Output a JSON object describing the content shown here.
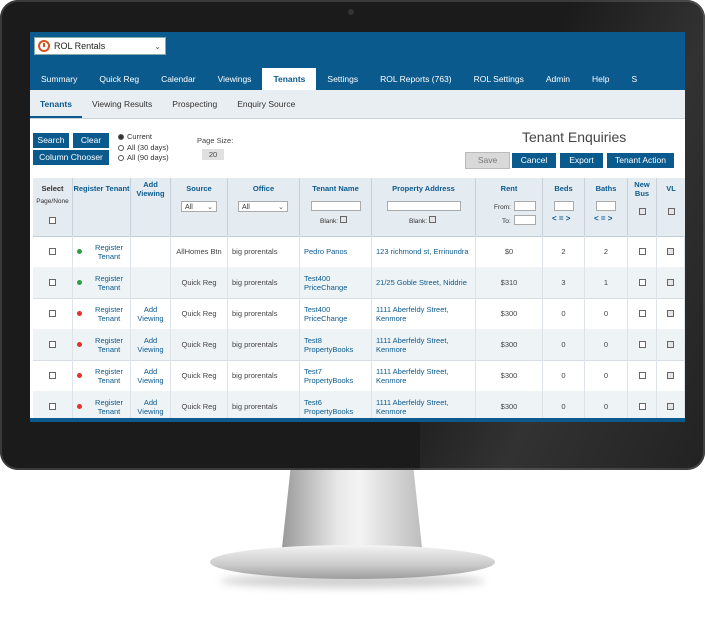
{
  "app": {
    "name": "ROL Rentals"
  },
  "nav": [
    "Summary",
    "Quick Reg",
    "Calendar",
    "Viewings",
    "Tenants",
    "Settings",
    "ROL Reports (763)",
    "ROL Settings",
    "Admin",
    "Help",
    "S"
  ],
  "subnav": [
    "Tenants",
    "Viewing Results",
    "Prospecting",
    "Enquiry Source"
  ],
  "controls": {
    "search": "Search",
    "clear": "Clear",
    "column_chooser": "Column Chooser",
    "radios": [
      "Current",
      "All (30 days)",
      "All (90 days)"
    ],
    "page_size_label": "Page Size:",
    "page_size": "20",
    "title": "Tenant Enquiries",
    "save": "Save",
    "cancel": "Cancel",
    "export": "Export",
    "tenant_action": "Tenant Action"
  },
  "headers": {
    "select": "Select",
    "page_none": "Page/None",
    "register_tenant": "Register Tenant",
    "add_viewing": "Add Viewing",
    "source": "Source",
    "source_filter": "All",
    "office": "Office",
    "office_filter": "All",
    "tenant_name": "Tenant Name",
    "property_address": "Property Address",
    "rent": "Rent",
    "from": "From:",
    "to": "To:",
    "blank": "Blank:",
    "beds": "Beds",
    "baths": "Baths",
    "new_bus": "New Bus",
    "vl": "VL",
    "arrows": "< = >"
  },
  "rows": [
    {
      "status": "#2e9e44",
      "register": "Register Tenant",
      "add": "",
      "source": "AllHomes Btn",
      "office": "big prorentals",
      "name": "Pedro Panos",
      "address": "123 richmond st, Errinundra",
      "rent": "$0",
      "beds": "2",
      "baths": "2"
    },
    {
      "status": "#2e9e44",
      "register": "Register Tenant",
      "add": "",
      "source": "Quick Reg",
      "office": "big prorentals",
      "name": "Test400 PriceChange",
      "address": "21/25 Goble Street, Niddrie",
      "rent": "$310",
      "beds": "3",
      "baths": "1"
    },
    {
      "status": "#e0332b",
      "register": "Register Tenant",
      "add": "Add Viewing",
      "source": "Quick Reg",
      "office": "big prorentals",
      "name": "Test400 PriceChange",
      "address": "1111 Aberfeldy Street, Kenmore",
      "rent": "$300",
      "beds": "0",
      "baths": "0"
    },
    {
      "status": "#e0332b",
      "register": "Register Tenant",
      "add": "Add Viewing",
      "source": "Quick Reg",
      "office": "big prorentals",
      "name": "Test8 PropertyBooks",
      "address": "1111 Aberfeldy Street, Kenmore",
      "rent": "$300",
      "beds": "0",
      "baths": "0"
    },
    {
      "status": "#e0332b",
      "register": "Register Tenant",
      "add": "Add Viewing",
      "source": "Quick Reg",
      "office": "big prorentals",
      "name": "Test7 PropertyBooks",
      "address": "1111 Aberfeldy Street, Kenmore",
      "rent": "$300",
      "beds": "0",
      "baths": "0"
    },
    {
      "status": "#e0332b",
      "register": "Register Tenant",
      "add": "Add Viewing",
      "source": "Quick Reg",
      "office": "big prorentals",
      "name": "Test6 PropertyBooks",
      "address": "1111 Aberfeldy Street, Kenmore",
      "rent": "$300",
      "beds": "0",
      "baths": "0"
    }
  ]
}
